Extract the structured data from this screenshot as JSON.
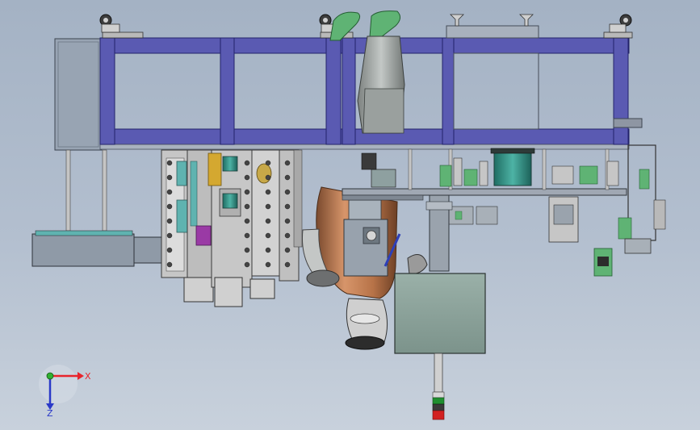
{
  "triad": {
    "x_label": "X",
    "z_label": "Z",
    "x_color": "#e8242c",
    "z_color": "#2a39c8",
    "y_color": "#30b030"
  },
  "colors": {
    "frame": "#5a5ab2",
    "frame_edge": "#23236a",
    "steel": "#c9c9c9",
    "steel_dark": "#8e8e8e",
    "panel": "#97a3b1",
    "cabinet": "#8aa19a",
    "robot": "#c9875f",
    "robot_dark": "#8c5a3b",
    "motor_teal": "#3c9a8e",
    "tool_green": "#5fb374",
    "accent_yellow": "#d4a830",
    "accent_magenta": "#9a3aa5",
    "light_red": "#d22020",
    "light_green": "#1f8f2f"
  }
}
